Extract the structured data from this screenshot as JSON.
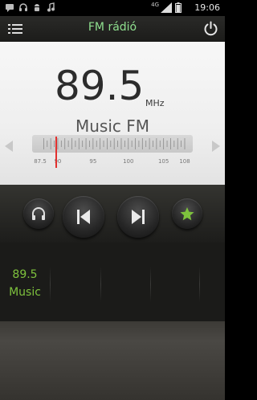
{
  "status_bar": {
    "network": "4G",
    "time": "19:06",
    "icons": [
      "message-icon",
      "headphones-icon",
      "android-icon",
      "music-icon",
      "signal-icon",
      "battery-icon"
    ]
  },
  "action_bar": {
    "title": "FM rádió",
    "menu_icon": "menu-icon",
    "power_icon": "power-icon"
  },
  "tuner": {
    "frequency": "89.5",
    "unit": "MHz",
    "station_name": "Music FM",
    "scale_labels": [
      "87.5",
      "90",
      "95",
      "100",
      "105",
      "108"
    ],
    "current_frequency_mhz": 89.5,
    "scale_min_mhz": 87.5,
    "scale_max_mhz": 108
  },
  "controls": {
    "headphones": "headphones-icon",
    "previous": "skip-previous-icon",
    "next": "skip-next-icon",
    "favorite": "star-icon"
  },
  "presets": [
    {
      "frequency": "89.5",
      "name": "Music"
    },
    {
      "frequency": "",
      "name": ""
    },
    {
      "frequency": "",
      "name": ""
    },
    {
      "frequency": "",
      "name": ""
    },
    {
      "frequency": "",
      "name": ""
    }
  ],
  "colors": {
    "accent_green": "#7ec23d",
    "title_green": "#8fe08f",
    "needle_red": "#e2312f"
  }
}
